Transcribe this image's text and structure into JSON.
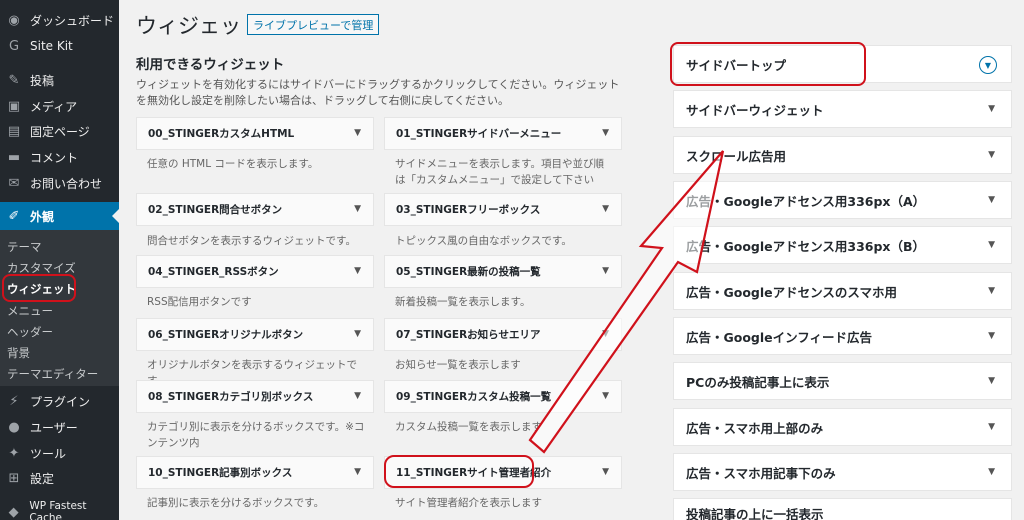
{
  "sidebar": {
    "menu": [
      {
        "icon": "dashboard-icon",
        "glyph": "◉",
        "label": "ダッシュボード"
      },
      {
        "icon": "google-icon",
        "glyph": "G",
        "label": "Site Kit"
      },
      {
        "icon": "pin-icon",
        "glyph": "✎",
        "label": "投稿"
      },
      {
        "icon": "media-icon",
        "glyph": "▣",
        "label": "メディア"
      },
      {
        "icon": "page-icon",
        "glyph": "▤",
        "label": "固定ページ"
      },
      {
        "icon": "comment-icon",
        "glyph": "▬",
        "label": "コメント"
      },
      {
        "icon": "mail-icon",
        "glyph": "✉",
        "label": "お問い合わせ"
      },
      {
        "icon": "appearance-icon",
        "glyph": "✐",
        "label": "外観"
      },
      {
        "icon": "plugin-icon",
        "glyph": "⚡",
        "label": "プラグイン"
      },
      {
        "icon": "user-icon",
        "glyph": "●",
        "label": "ユーザー"
      },
      {
        "icon": "tool-icon",
        "glyph": "✦",
        "label": "ツール"
      },
      {
        "icon": "settings-icon",
        "glyph": "⊞",
        "label": "設定"
      },
      {
        "icon": "cache-icon",
        "glyph": "◆",
        "label": "WP Fastest Cache"
      }
    ],
    "submenu": [
      "テーマ",
      "カスタマイズ",
      "ウィジェット",
      "メニュー",
      "ヘッダー",
      "背景",
      "テーマエディター"
    ]
  },
  "header": {
    "title": "ウィジェット",
    "manage_button": "ライブプレビューで管理"
  },
  "available": {
    "title": "利用できるウィジェット",
    "description": "ウィジェットを有効化するにはサイドバーにドラッグするかクリックしてください。ウィジェットを無効化し設定を削除したい場合は、ドラッグして右側に戻してください。"
  },
  "widgets": [
    {
      "name": "00_STINGERカスタムHTML",
      "desc": "任意の HTML コードを表示します。"
    },
    {
      "name": "01_STINGERサイドバーメニュー",
      "desc": "サイドメニューを表示します。項目や並び順は「カスタムメニュー」で設定して下さい"
    },
    {
      "name": "02_STINGER問合せボタン",
      "desc": "問合せボタンを表示するウィジェットです。"
    },
    {
      "name": "03_STINGERフリーボックス",
      "desc": "トピックス風の自由なボックスです。"
    },
    {
      "name": "04_STINGER_RSSボタン",
      "desc": "RSS配信用ボタンです"
    },
    {
      "name": "05_STINGER最新の投稿一覧",
      "desc": "新着投稿一覧を表示します。"
    },
    {
      "name": "06_STINGERオリジナルボタン",
      "desc": "オリジナルボタンを表示するウィジェットです。"
    },
    {
      "name": "07_STINGERお知らせエリア",
      "desc": "お知らせ一覧を表示します"
    },
    {
      "name": "08_STINGERカテゴリ別ボックス",
      "desc": "カテゴリ別に表示を分けるボックスです。※コンテンツ内"
    },
    {
      "name": "09_STINGERカスタム投稿一覧",
      "desc": "カスタム投稿一覧を表示します"
    },
    {
      "name": "10_STINGER記事別ボックス",
      "desc": "記事別に表示を分けるボックスです。"
    },
    {
      "name": "11_STINGERサイト管理者紹介",
      "desc": "サイト管理者紹介を表示します"
    }
  ],
  "areas": [
    "サイドバートップ",
    "サイドバーウィジェット",
    "スクロール広告用",
    "広告・Googleアドセンス用336px（A）",
    "広告・Googleアドセンス用336px（B）",
    "広告・Googleアドセンスのスマホ用",
    "広告・Googleインフィード広告",
    "PCのみ投稿記事上に表示",
    "広告・スマホ用上部のみ",
    "広告・スマホ用記事下のみ",
    "投稿記事の上に一括表示"
  ],
  "colors": {
    "accent": "#0073aa",
    "highlight": "#d0111b",
    "sidebar_bg": "#23282d"
  }
}
